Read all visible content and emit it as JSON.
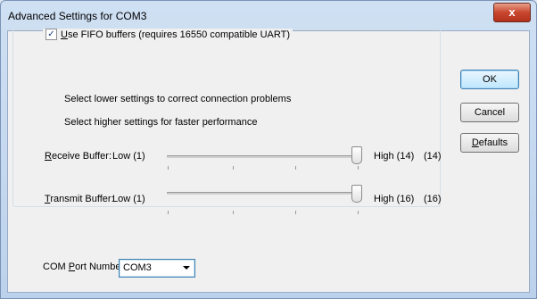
{
  "window": {
    "title": "Advanced Settings for COM3",
    "close_label": "x"
  },
  "fifo": {
    "checked": true,
    "check_glyph": "✓",
    "label_underlined": "U",
    "label_rest": "se FIFO buffers (requires 16550 compatible UART)"
  },
  "hints": {
    "lower": "Select lower settings to correct connection problems",
    "higher": "Select higher settings for faster performance"
  },
  "receive": {
    "label_underlined": "R",
    "label_rest": "eceive Buffer:",
    "low": "Low (1)",
    "high": "High (14)",
    "value": "(14)",
    "min": 1,
    "max": 14,
    "current": 14
  },
  "transmit": {
    "label_underlined": "T",
    "label_rest": "ransmit Buffer:",
    "low": "Low (1)",
    "high": "High (16)",
    "value": "(16)",
    "min": 1,
    "max": 16,
    "current": 16
  },
  "buttons": {
    "ok": "OK",
    "cancel": "Cancel",
    "defaults_underlined": "D",
    "defaults_rest": "efaults"
  },
  "com_port": {
    "label_pre": "COM ",
    "label_underlined": "P",
    "label_rest": "ort Number:",
    "selected": "COM3"
  }
}
